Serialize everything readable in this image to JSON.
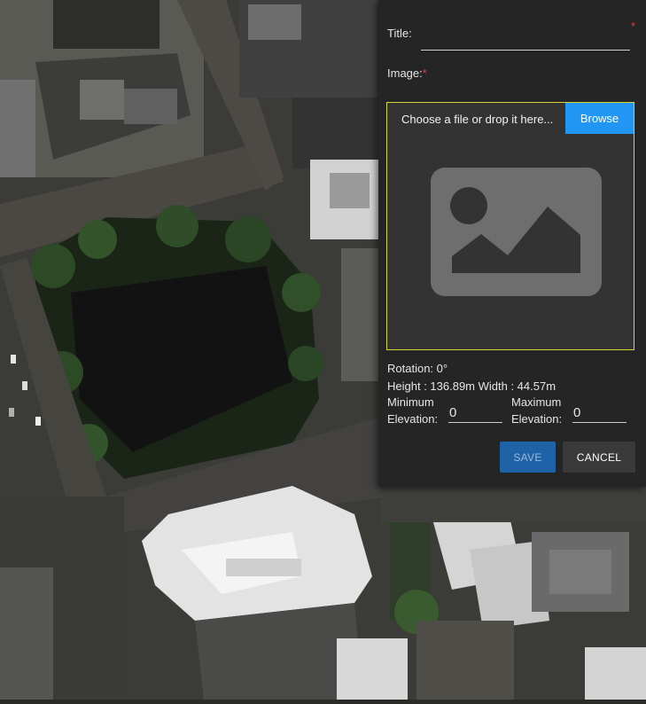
{
  "form": {
    "title_label": "Title:",
    "title_required": "*",
    "title_value": "",
    "image_label": "Image:",
    "image_required": "*",
    "file_prompt": "Choose a file or drop it here...",
    "browse_label": "Browse",
    "placeholder_icon": "image-placeholder-icon",
    "rotation_text": "Rotation: 0°",
    "dimensions_text": "Height : 136.89m Width : 44.57m",
    "min_elevation_label_line1": "Minimum",
    "min_elevation_label_line2": "Elevation:",
    "min_elevation_value": "0",
    "max_elevation_label_line1": "Maximum",
    "max_elevation_label_line2": "Elevation:",
    "max_elevation_value": "0",
    "save_label": "SAVE",
    "cancel_label": "CANCEL"
  },
  "colors": {
    "panel_bg": "#252525",
    "browse_blue": "#2196f3",
    "save_blue": "#1e62a8",
    "required_red": "#e53935",
    "dropzone_border": "#d6d63a"
  }
}
